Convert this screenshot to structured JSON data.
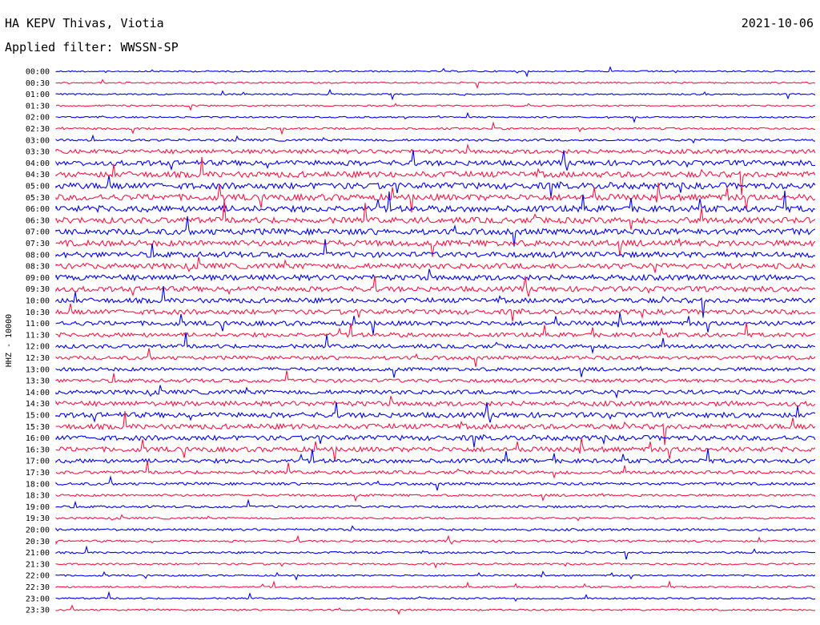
{
  "header": {
    "station": "HA KEPV Thivas, Viotia",
    "filter": "Applied filter: WWSSN-SP",
    "date": "2021-10-06"
  },
  "chart_data": {
    "type": "line",
    "title": "HA KEPV Thivas, Viotia",
    "subtitle": "Applied filter: WWSSN-SP",
    "date": "2021-10-06",
    "ylabel": "HHZ - 10000",
    "xlabel": "",
    "row_labels": [
      "00:00",
      "00:30",
      "01:00",
      "01:30",
      "02:00",
      "02:30",
      "03:00",
      "03:30",
      "04:00",
      "04:30",
      "05:00",
      "05:30",
      "06:00",
      "06:30",
      "07:00",
      "07:30",
      "08:00",
      "08:30",
      "09:00",
      "09:30",
      "10:00",
      "10:30",
      "11:00",
      "11:30",
      "12:00",
      "12:30",
      "13:00",
      "13:30",
      "14:00",
      "14:30",
      "15:00",
      "15:30",
      "16:00",
      "16:30",
      "17:00",
      "17:30",
      "18:00",
      "18:30",
      "19:00",
      "19:30",
      "20:00",
      "20:30",
      "21:00",
      "21:30",
      "22:00",
      "22:30",
      "23:00",
      "23:30"
    ],
    "series_colors": [
      "#0000ff",
      "#ff1744"
    ],
    "amplitude_level": [
      0.9,
      0.9,
      0.9,
      0.9,
      0.9,
      1.2,
      1.4,
      2.6,
      3.2,
      3.6,
      3.8,
      3.8,
      3.8,
      3.6,
      3.6,
      3.6,
      3.4,
      3.4,
      3.4,
      3.2,
      3.0,
      3.0,
      2.8,
      2.6,
      2.4,
      2.2,
      2.2,
      2.2,
      2.6,
      3.0,
      3.2,
      3.2,
      3.0,
      3.0,
      2.6,
      2.0,
      1.6,
      1.4,
      1.4,
      1.2,
      1.4,
      1.2,
      1.2,
      1.1,
      1.0,
      1.1,
      1.0,
      1.0
    ],
    "grid": false,
    "legend": "none"
  }
}
